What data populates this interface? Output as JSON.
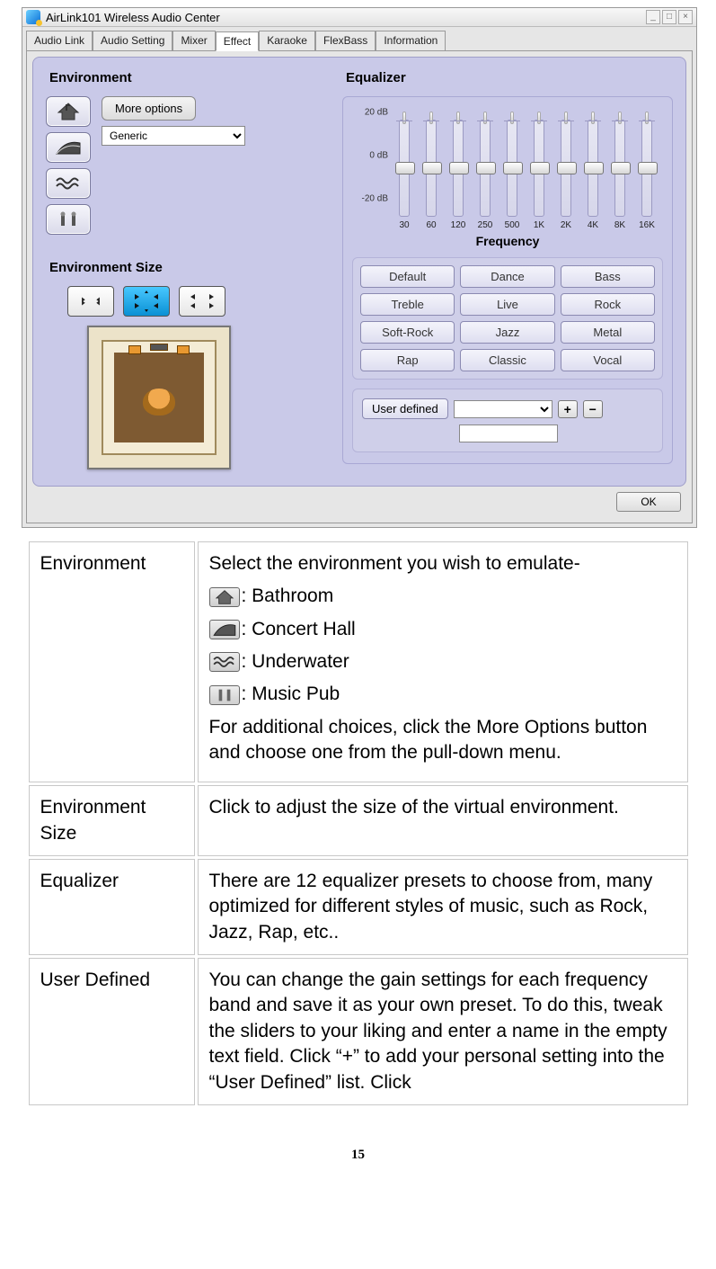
{
  "window": {
    "title": "AirLink101 Wireless Audio Center",
    "tabs": [
      "Audio Link",
      "Audio Setting",
      "Mixer",
      "Effect",
      "Karaoke",
      "FlexBass",
      "Information"
    ],
    "active_tab": 3,
    "ok": "OK"
  },
  "environment": {
    "title": "Environment",
    "more_options": "More options",
    "selected_preset": "Generic",
    "icons": [
      "bathroom-icon",
      "concert-hall-icon",
      "underwater-icon",
      "music-pub-icon"
    ]
  },
  "environment_size": {
    "title": "Environment Size",
    "selected_index": 1
  },
  "equalizer": {
    "title": "Equalizer",
    "y_labels": [
      "20 dB",
      "0  dB",
      "-20 dB"
    ],
    "frequencies": [
      "30",
      "60",
      "120",
      "250",
      "500",
      "1K",
      "2K",
      "4K",
      "8K",
      "16K"
    ],
    "x_label": "Frequency",
    "presets": [
      "Default",
      "Dance",
      "Bass",
      "Treble",
      "Live",
      "Rock",
      "Soft-Rock",
      "Jazz",
      "Metal",
      "Rap",
      "Classic",
      "Vocal"
    ],
    "user_defined_label": "User defined",
    "user_defined_value": "",
    "user_defined_name": ""
  },
  "chart_data": {
    "type": "bar",
    "title": "Equalizer",
    "xlabel": "Frequency",
    "ylabel": "dB",
    "ylim": [
      -20,
      20
    ],
    "categories": [
      "30",
      "60",
      "120",
      "250",
      "500",
      "1K",
      "2K",
      "4K",
      "8K",
      "16K"
    ],
    "values": [
      0,
      0,
      0,
      0,
      0,
      0,
      0,
      0,
      0,
      0
    ]
  },
  "doc": {
    "rows": [
      {
        "key": "Environment",
        "intro": "Select the environment you wish to emulate-",
        "items": [
          {
            "icon": "bathroom-icon",
            "text": ": Bathroom"
          },
          {
            "icon": "concert-hall-icon",
            "text": ": Concert Hall"
          },
          {
            "icon": "underwater-icon",
            "text": ": Underwater"
          },
          {
            "icon": "music-pub-icon",
            "text": ": Music Pub"
          }
        ],
        "outro": "For additional choices, click the More Options button and choose one from the pull-down menu."
      },
      {
        "key": "Environment Size",
        "val": "Click to adjust the size of the virtual environment."
      },
      {
        "key": "Equalizer",
        "val": "There are 12 equalizer presets to choose from, many optimized for different styles of music, such as Rock, Jazz, Rap, etc.."
      },
      {
        "key": "User Defined",
        "val": "You can change the gain settings for each frequency band and save it as your own preset. To do this, tweak the sliders to your liking and enter a name in the empty text field. Click “+” to add your personal setting into the “User Defined” list. Click"
      }
    ]
  },
  "page_number": "15"
}
